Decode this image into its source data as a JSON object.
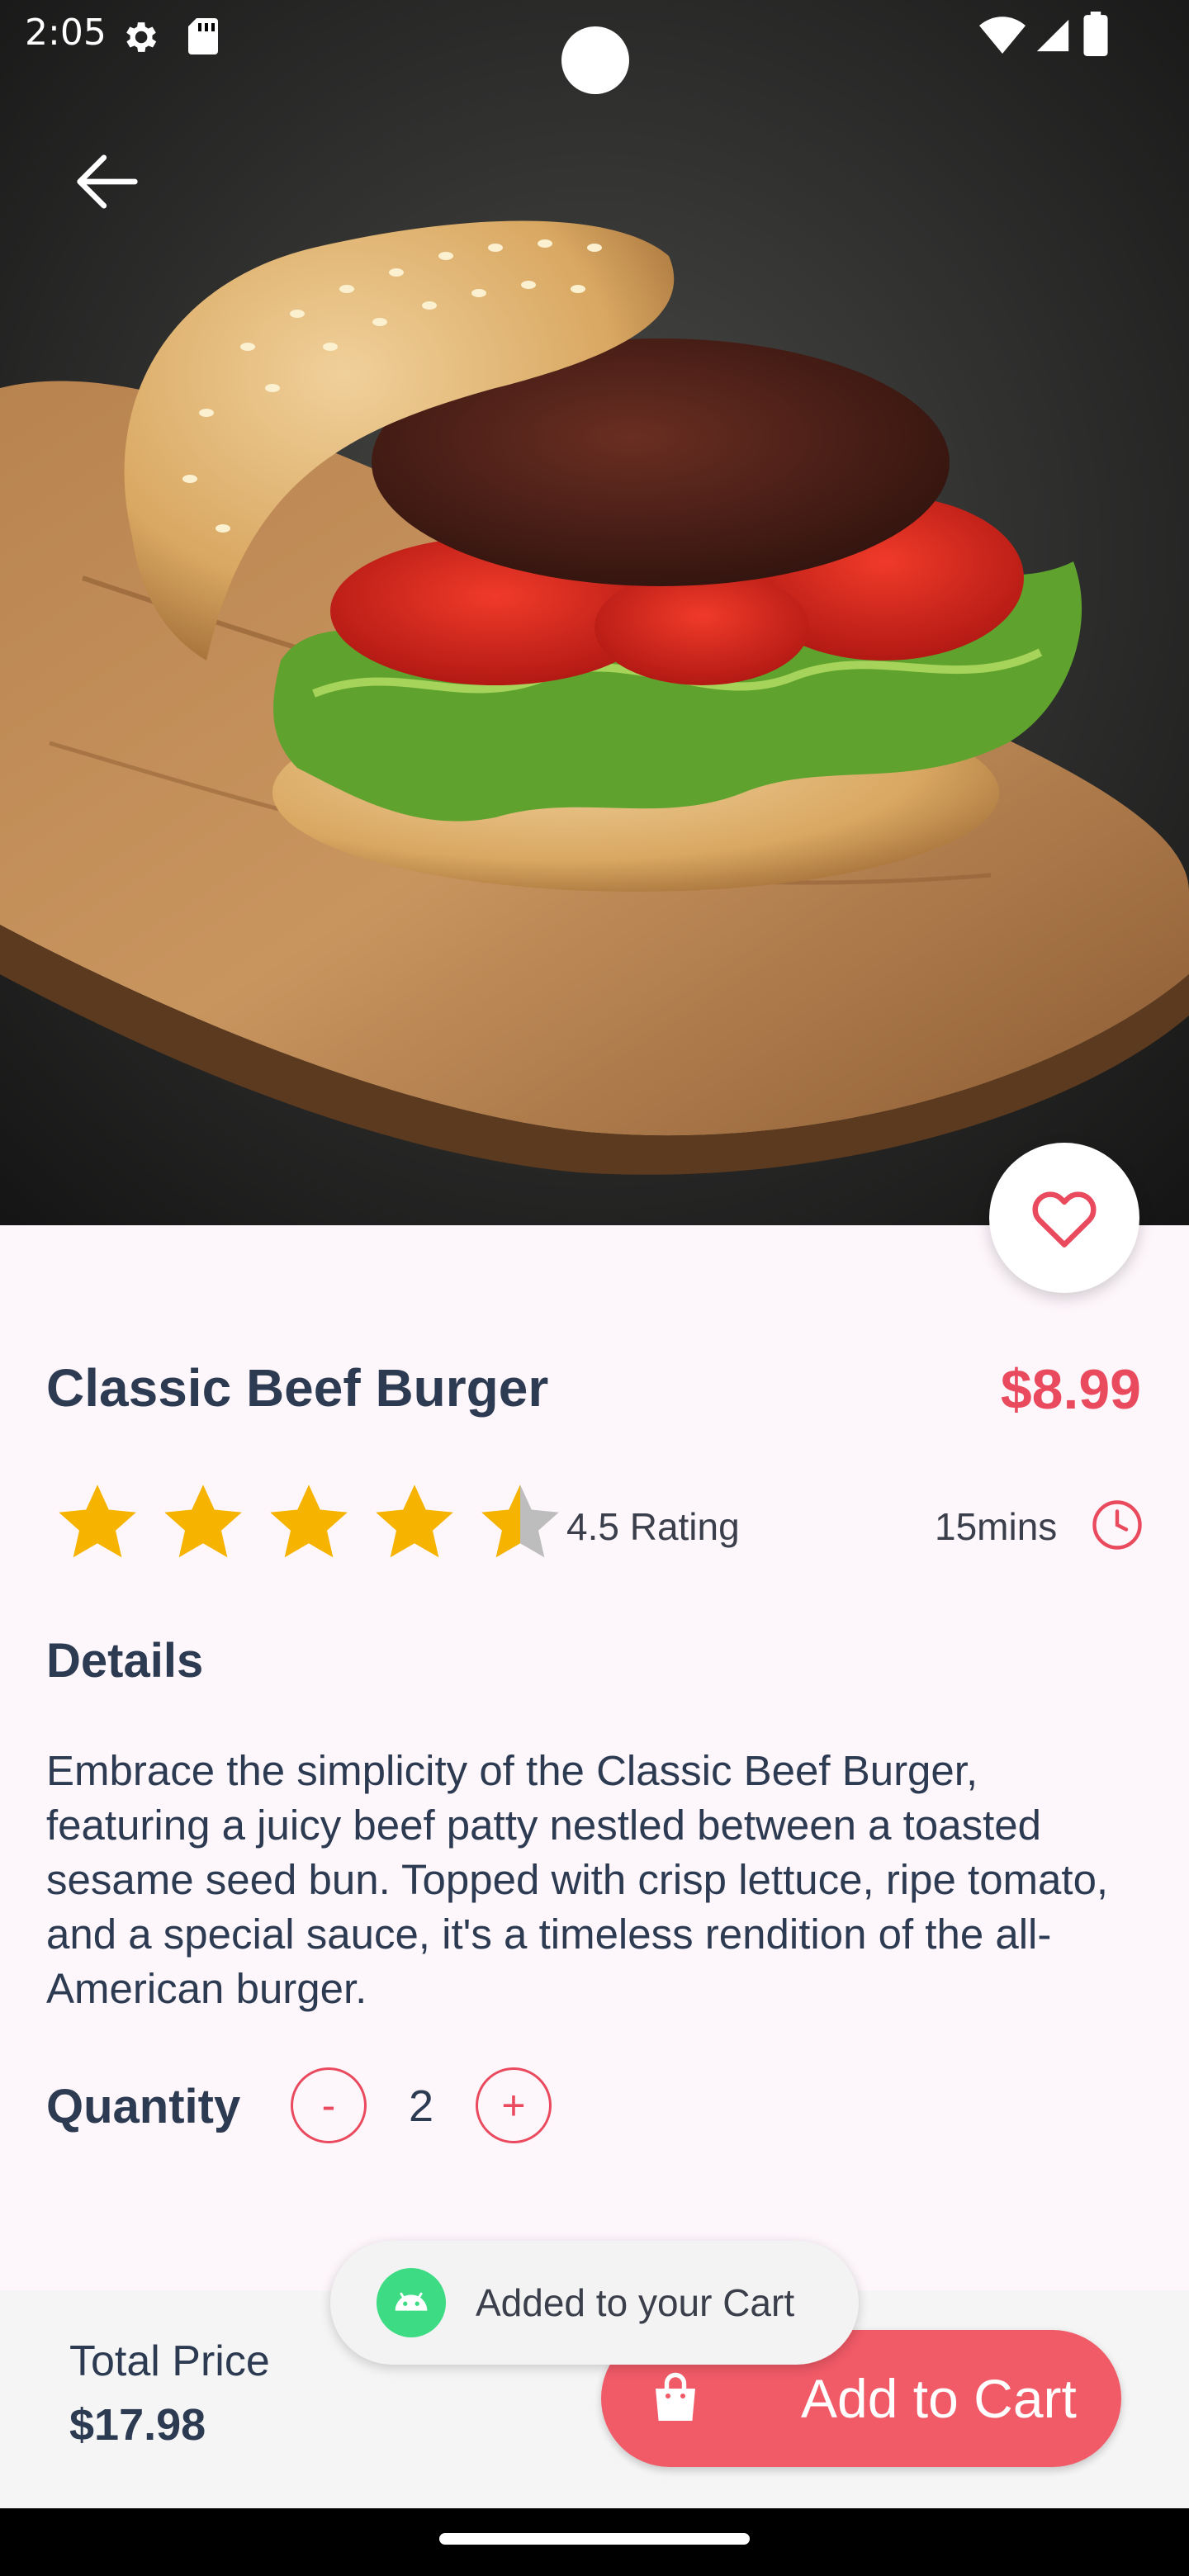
{
  "status_bar": {
    "time": "2:05"
  },
  "product": {
    "title": "Classic Beef Burger",
    "price": "$8.99",
    "rating": 4.5,
    "rating_text": "4.5 Rating",
    "prep_time": "15mins",
    "details_heading": "Details",
    "description": "Embrace the simplicity of the Classic Beef Burger, featuring a juicy beef patty nestled between a toasted sesame seed bun. Topped with crisp lettuce, ripe tomato, and a special sauce, it's a timeless rendition of the all-American burger."
  },
  "quantity": {
    "label": "Quantity",
    "minus": "-",
    "plus": "+",
    "value": "2"
  },
  "checkout": {
    "total_label": "Total Price",
    "total_value": "$17.98",
    "add_to_cart": "Add to Cart"
  },
  "toast": {
    "message": "Added to your Cart"
  },
  "colors": {
    "accent": "#ea4a5e",
    "text": "#2d3b52",
    "background": "#fdf6fb",
    "star": "#f6b400"
  },
  "icons": [
    "back-arrow-icon",
    "heart-icon",
    "star-icon",
    "clock-icon",
    "shopping-bag-icon",
    "android-icon",
    "settings-icon",
    "sd-card-icon",
    "wifi-icon",
    "signal-icon",
    "battery-icon"
  ]
}
